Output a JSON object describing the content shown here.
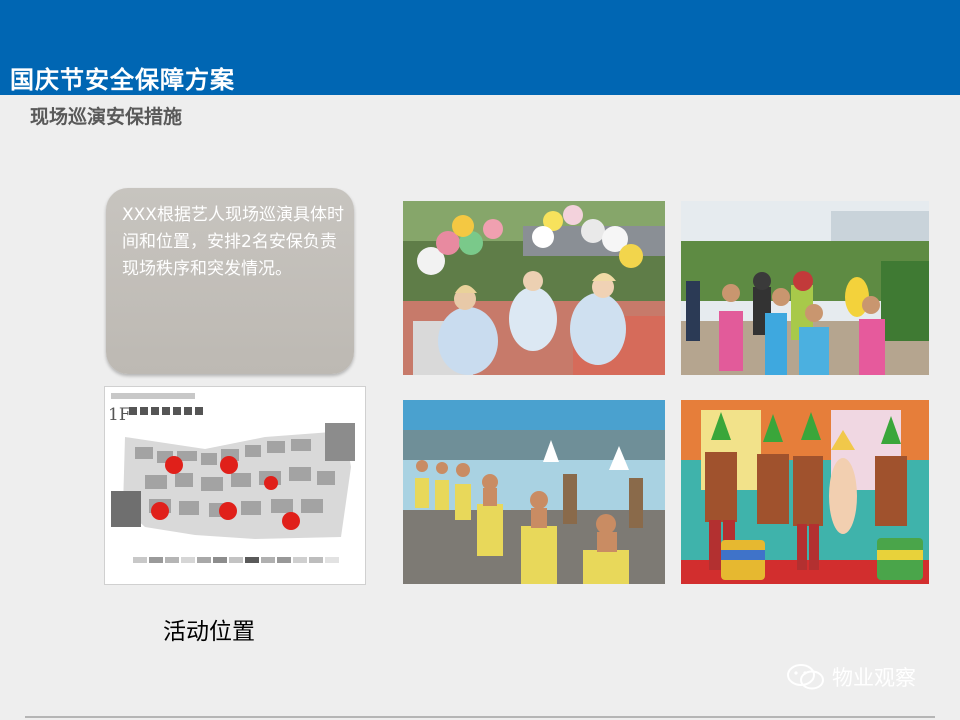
{
  "header": {
    "title": "国庆节安全保障方案"
  },
  "subtitle": "现场巡演安保措施",
  "callout": {
    "text": "XXX根据艺人现场巡演具体时间和位置，安排2名安保负责现场秩序和突发情况。"
  },
  "floorplan": {
    "floor": "1F"
  },
  "caption": "活动位置",
  "watermark": {
    "text": "物业观察",
    "icon": "wechat-icon"
  },
  "colors": {
    "header": "#0066b3",
    "callout": "#c2bfba",
    "marker": "#e0201a"
  }
}
